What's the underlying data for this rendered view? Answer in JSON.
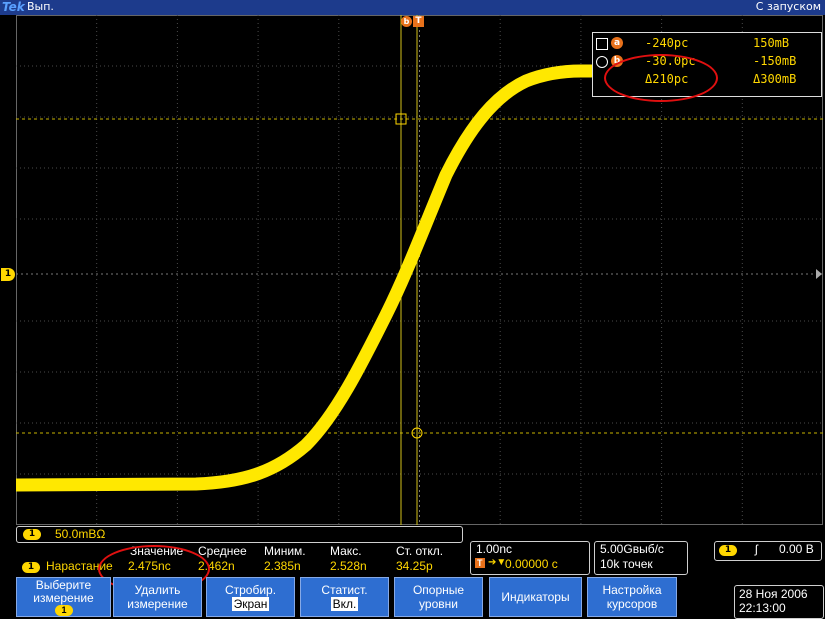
{
  "header": {
    "logo": "Tek",
    "status": "Вып.",
    "trigger_mode": "С запуском"
  },
  "markers": {
    "cursor_a": "a",
    "cursor_b": "b",
    "trigger": "T",
    "channel_level": "1"
  },
  "cursor_readout": {
    "rows": [
      {
        "label": "a",
        "time": "-240pc",
        "value": "150mB"
      },
      {
        "label": "b",
        "time": "-30.0pc",
        "value": "-150mB"
      },
      {
        "label": "",
        "time": "Δ210pc",
        "value": "Δ300mB"
      }
    ]
  },
  "channel": {
    "number": "1",
    "scale": "50.0mBΩ"
  },
  "measurements": {
    "headers": {
      "value": "Значение",
      "mean": "Среднее",
      "min": "Миним.",
      "max": "Макс.",
      "stdev": "Ст. откл."
    },
    "row": {
      "channel": "1",
      "name": "Нарастание",
      "value": "2.475nc",
      "mean": "2.462n",
      "min": "2.385n",
      "max": "2.528n",
      "stdev": "34.25p"
    }
  },
  "timebase": {
    "scale": "1.00nc",
    "position": "0.00000 c"
  },
  "acquisition": {
    "rate": "5.00Gвыб/с",
    "points": "10k точек"
  },
  "trigger": {
    "channel": "1",
    "slope_symbol": "ʃ",
    "level": "0.00 B"
  },
  "softkeys": [
    {
      "line1": "Выберите",
      "line2": "измерение",
      "badge": "1"
    },
    {
      "line1": "Удалить",
      "line2": "измерение"
    },
    {
      "line1": "Стробир.",
      "line2": "Экран"
    },
    {
      "line1": "Статист.",
      "line2": "Вкл."
    },
    {
      "line1": "Опорные",
      "line2": "уровни"
    },
    {
      "line1": "Индикаторы",
      "line2": ""
    },
    {
      "line1": "Настройка",
      "line2": "курсоров"
    }
  ],
  "datetime": {
    "date": "28 Ноя 2006",
    "time": "22:13:00"
  },
  "colors": {
    "trace": "#ffd700",
    "softkey_bg": "#2e6ed1",
    "header_bg": "#1d3b8c",
    "annotation": "#e01010"
  }
}
